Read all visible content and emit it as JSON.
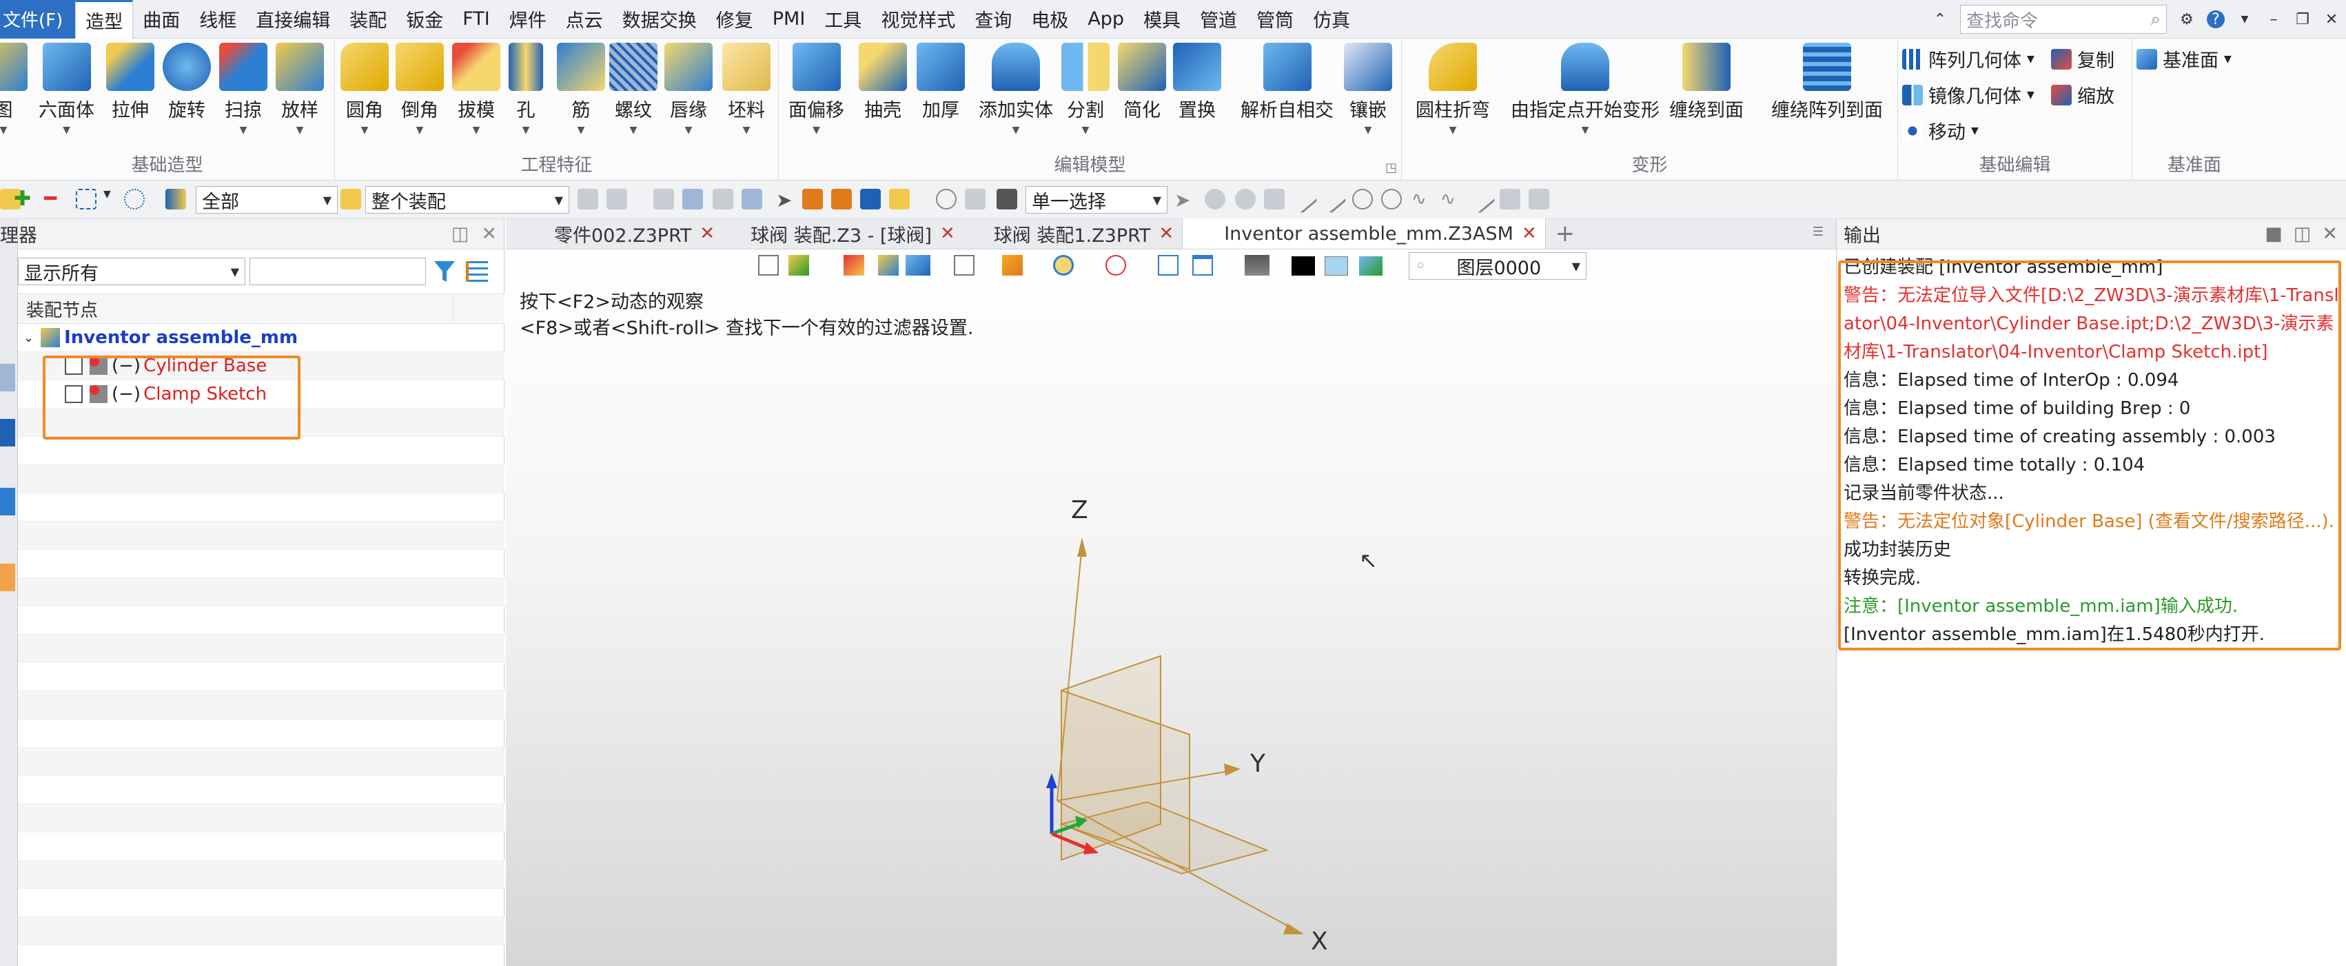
{
  "menubar": {
    "file": "文件(F)",
    "items": [
      "造型",
      "曲面",
      "线框",
      "直接编辑",
      "装配",
      "钣金",
      "FTI",
      "焊件",
      "点云",
      "数据交换",
      "修复",
      "PMI",
      "工具",
      "视觉样式",
      "查询",
      "电极",
      "App",
      "模具",
      "管道",
      "管筒",
      "仿真"
    ],
    "active": "造型",
    "search_placeholder": "查找命令"
  },
  "ribbon": {
    "groups": [
      {
        "label": "基础造型",
        "buttons": [
          "图",
          "六面体",
          "拉伸",
          "旋转",
          "扫掠",
          "放样"
        ]
      },
      {
        "label": "工程特征",
        "buttons": [
          "圆角",
          "倒角",
          "拔模",
          "孔",
          "筋",
          "螺纹",
          "唇缘",
          "坯料"
        ]
      },
      {
        "label": "编辑模型",
        "buttons": [
          "面偏移",
          "抽壳",
          "加厚",
          "添加实体",
          "分割",
          "简化",
          "置换",
          "解析自相交",
          "镶嵌"
        ]
      },
      {
        "label": "变形",
        "buttons": [
          "圆柱折弯",
          "由指定点开始变形",
          "缠绕到面",
          "缠绕阵列到面"
        ]
      },
      {
        "label": "基础编辑",
        "rows": [
          "阵列几何体",
          "复制",
          "镜像几何体",
          "缩放",
          "移动"
        ]
      },
      {
        "label": "基准面",
        "rows": [
          "基准面"
        ]
      }
    ]
  },
  "toolbar": {
    "filter_all": "全部",
    "assembly_scope": "整个装配",
    "select_mode": "单一选择"
  },
  "left_panel": {
    "title": "理器",
    "filter_value": "显示所有",
    "tree_header": "装配节点",
    "root": "Inventor assemble_mm",
    "children": [
      {
        "prefix": "(−)",
        "label": "Cylinder Base"
      },
      {
        "prefix": "(−)",
        "label": "Clamp Sketch"
      }
    ]
  },
  "tabs": [
    {
      "label": "零件002.Z3PRT"
    },
    {
      "label": "球阀 装配.Z3 - [球阀]"
    },
    {
      "label": "球阀 装配1.Z3PRT"
    },
    {
      "label": "Inventor assemble_mm.Z3ASM",
      "active": true
    }
  ],
  "viewport": {
    "hint1": "按下<F2>动态的观察",
    "hint2": "<F8>或者<Shift-roll> 查找下一个有效的过滤器设置.",
    "layer": "图层0000",
    "axes": {
      "x": "X",
      "y": "Y",
      "z": "Z"
    }
  },
  "output": {
    "title": "输出",
    "lines": [
      {
        "text": "已创建装配 [Inventor assemble_mm]",
        "kind": "info"
      },
      {
        "text": "警告：无法定位导入文件[D:\\2_ZW3D\\3-演示素材库\\1-Translator\\04-Inventor\\Cylinder Base.ipt;D:\\2_ZW3D\\3-演示素材库\\1-Translator\\04-Inventor\\Clamp Sketch.ipt]",
        "kind": "warn"
      },
      {
        "text": "信息：Elapsed time of InterOp : 0.094",
        "kind": "info"
      },
      {
        "text": "信息：Elapsed time of building Brep : 0",
        "kind": "info"
      },
      {
        "text": "信息：Elapsed time of creating assembly : 0.003",
        "kind": "info"
      },
      {
        "text": "信息：Elapsed time totally : 0.104",
        "kind": "info"
      },
      {
        "text": "记录当前零件状态...",
        "kind": "info"
      },
      {
        "text": "警告：无法定位对象[Cylinder Base] (查看文件/搜索路径...).",
        "kind": "orange"
      },
      {
        "text": "成功封装历史",
        "kind": "info"
      },
      {
        "text": "转换完成.",
        "kind": "info"
      },
      {
        "text": "注意：[Inventor assemble_mm.iam]输入成功.",
        "kind": "green"
      },
      {
        "text": "[Inventor assemble_mm.iam]在1.5480秒内打开.",
        "kind": "info"
      }
    ]
  },
  "colors": {
    "accent": "#2c6fc4",
    "highlight": "#f08a24",
    "warn": "#e53030",
    "note": "#2a9a2a"
  }
}
